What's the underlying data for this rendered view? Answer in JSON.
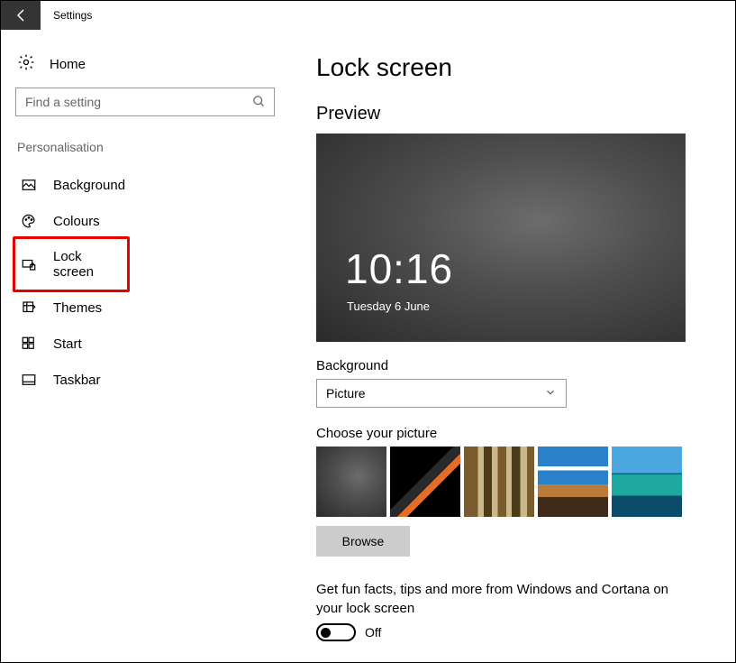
{
  "titlebar": {
    "title": "Settings"
  },
  "sidebar": {
    "home_label": "Home",
    "search_placeholder": "Find a setting",
    "section_label": "Personalisation",
    "items": [
      {
        "label": "Background"
      },
      {
        "label": "Colours"
      },
      {
        "label": "Lock screen"
      },
      {
        "label": "Themes"
      },
      {
        "label": "Start"
      },
      {
        "label": "Taskbar"
      }
    ]
  },
  "main": {
    "heading": "Lock screen",
    "preview_label": "Preview",
    "preview": {
      "time": "10:16",
      "date": "Tuesday 6 June"
    },
    "background_label": "Background",
    "background_value": "Picture",
    "choose_label": "Choose your picture",
    "browse_label": "Browse",
    "tips_text": "Get fun facts, tips and more from Windows and Cortana on your lock screen",
    "tips_toggle_state": "Off"
  }
}
